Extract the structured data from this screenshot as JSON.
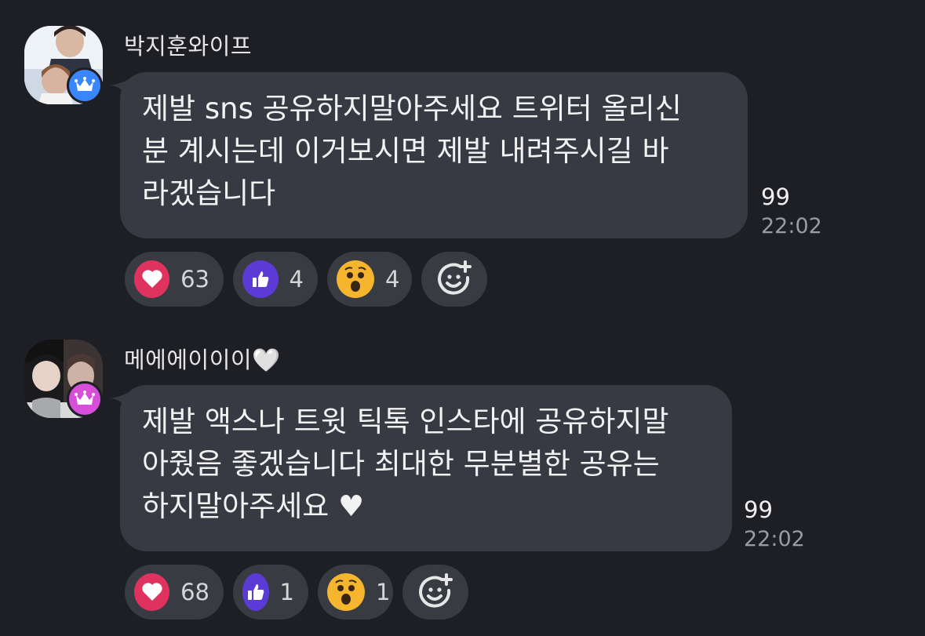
{
  "messages": [
    {
      "sender": "박지훈와이프",
      "badge_color": "#3a86ff",
      "text": "제발 sns 공유하지말아주세요 트위터 올리신\n분 계시는데 이거보시면 제발 내려주시길 바\n라겠습니다",
      "read_count": "99",
      "time": "22:02",
      "reactions": [
        {
          "icon": "heart-icon",
          "count": "63",
          "color": "#e0325f"
        },
        {
          "icon": "thumbs-up-icon",
          "count": "4",
          "color": "#5b3ad6"
        },
        {
          "icon": "surprised-face-icon",
          "count": "4",
          "color": "#f5b52e"
        }
      ]
    },
    {
      "sender": "메에에이이이🤍",
      "badge_color": "#d74fd8",
      "text": "제발 액스나 트윗 틱톡 인스타에 공유하지말\n아줬음 좋겠습니다 최대한 무분별한 공유는\n하지말아주세요 ♥",
      "read_count": "99",
      "time": "22:02",
      "reactions": [
        {
          "icon": "heart-icon",
          "count": "68",
          "color": "#e0325f"
        },
        {
          "icon": "thumbs-up-icon",
          "count": "1",
          "color": "#5b3ad6"
        },
        {
          "icon": "surprised-face-icon",
          "count": "1",
          "color": "#f5b52e"
        }
      ]
    }
  ]
}
